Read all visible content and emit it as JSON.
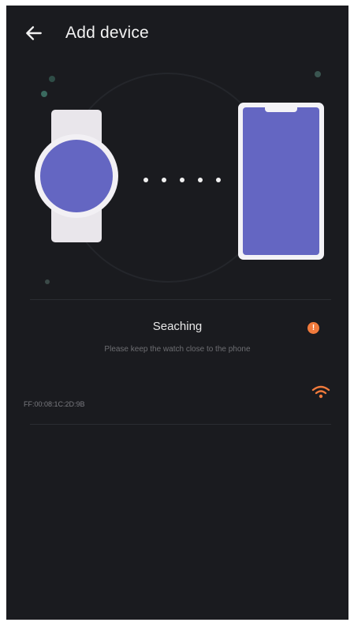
{
  "header": {
    "title": "Add device"
  },
  "status": {
    "title": "Seaching",
    "hint": "Please keep the watch close to the phone",
    "help_badge": "!"
  },
  "devices": [
    {
      "id": "FF:00:08:1C:2D:9B",
      "signal_icon": "wifi-signal-icon"
    }
  ],
  "colors": {
    "background": "#1a1b1f",
    "accent": "#6466c2",
    "badge": "#f07a3c",
    "signal": "#f07a3c"
  },
  "icons": {
    "back": "back-arrow-icon",
    "watch": "watch-icon",
    "phone": "phone-icon"
  }
}
